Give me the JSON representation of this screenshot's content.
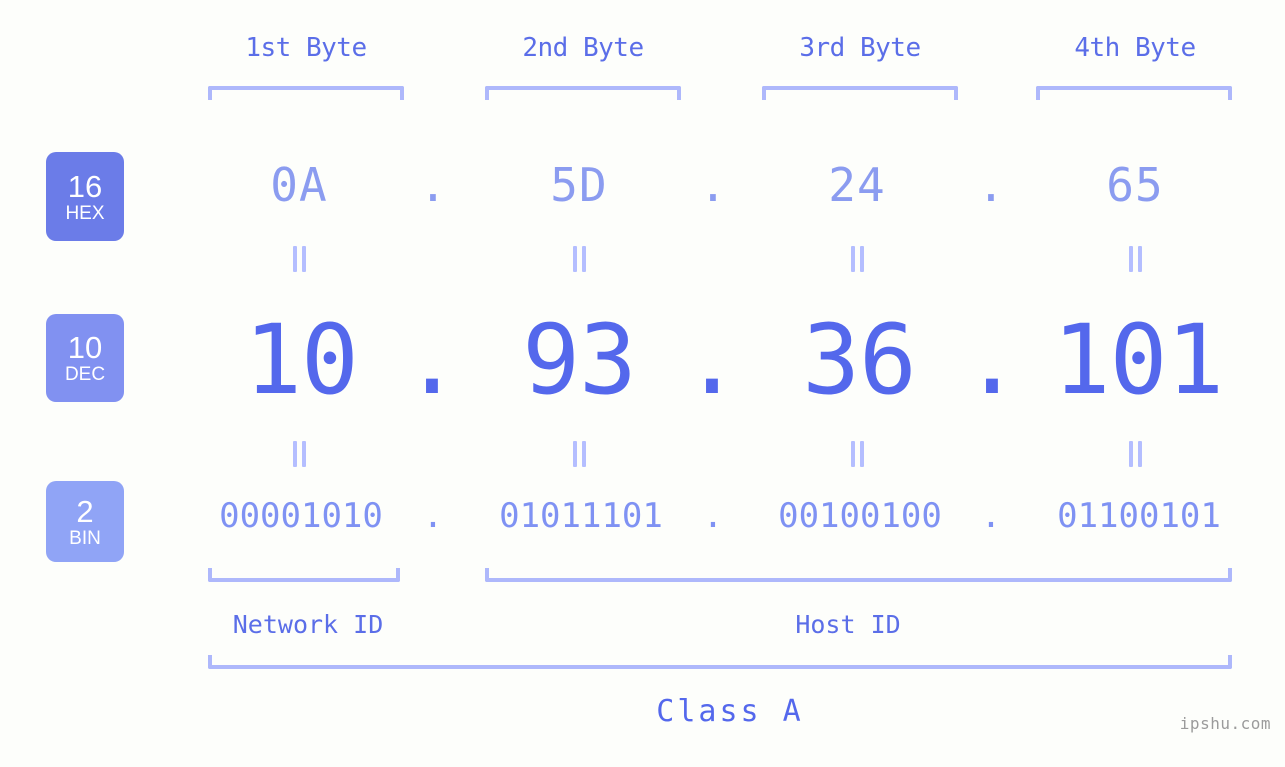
{
  "page": {
    "background": "#fdfefb",
    "accent": "#5468ec",
    "bracket_color": "#aeb8fb",
    "watermark": "ipshu.com"
  },
  "headers": [
    {
      "label": "1st Byte"
    },
    {
      "label": "2nd Byte"
    },
    {
      "label": "3rd Byte"
    },
    {
      "label": "4th Byte"
    }
  ],
  "bases": [
    {
      "radix": "16",
      "name": "HEX",
      "color": "#6b7ce8"
    },
    {
      "radix": "10",
      "name": "DEC",
      "color": "#8191f1"
    },
    {
      "radix": "2",
      "name": "BIN",
      "color": "#90a4f6"
    }
  ],
  "rows": {
    "hex": {
      "octets": [
        "0A",
        "5D",
        "24",
        "65"
      ],
      "separator": ".",
      "color": "#8b9cf0"
    },
    "dec": {
      "octets": [
        "10",
        "93",
        "36",
        "101"
      ],
      "separator": ".",
      "color": "#5468ec"
    },
    "bin": {
      "octets": [
        "00001010",
        "01011101",
        "00100100",
        "01100101"
      ],
      "separator": ".",
      "color": "#7f92f3"
    }
  },
  "equals_marks": {
    "symbol": "=",
    "count_per_row": 4,
    "color": "#b4beff"
  },
  "segments": {
    "network_id": "Network ID",
    "host_id": "Host ID",
    "class": "Class A"
  }
}
